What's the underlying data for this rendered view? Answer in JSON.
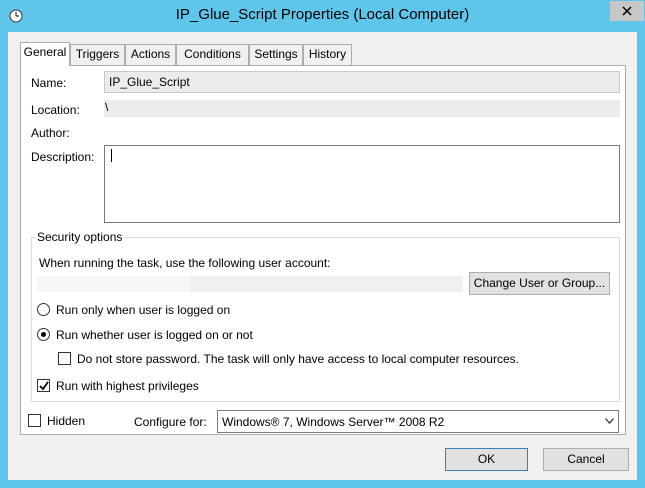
{
  "window": {
    "title": "IP_Glue_Script Properties (Local Computer)",
    "close_icon": "close-icon",
    "app_icon": "clock-icon"
  },
  "tabs": [
    {
      "label": "General",
      "active": true
    },
    {
      "label": "Triggers"
    },
    {
      "label": "Actions"
    },
    {
      "label": "Conditions"
    },
    {
      "label": "Settings"
    },
    {
      "label": "History"
    }
  ],
  "general": {
    "name_label": "Name:",
    "name_value": "IP_Glue_Script",
    "location_label": "Location:",
    "location_value": "\\",
    "author_label": "Author:",
    "author_value": "",
    "description_label": "Description:",
    "description_value": ""
  },
  "security": {
    "legend": "Security options",
    "account_prompt": "When running the task, use the following user account:",
    "account_value": "",
    "change_user_button": "Change User or Group...",
    "radio_logged_on": "Run only when user is logged on",
    "radio_whether": "Run whether user is logged on or not",
    "selected_radio": "whether",
    "no_store_password": "Do not store password.  The task will only have access to local computer resources.",
    "no_store_password_checked": false,
    "highest_privileges": "Run with highest privileges",
    "highest_privileges_checked": true
  },
  "footer_options": {
    "hidden_label": "Hidden",
    "hidden_checked": false,
    "configure_label": "Configure for:",
    "configure_value": "Windows® 7, Windows Server™ 2008 R2"
  },
  "buttons": {
    "ok": "OK",
    "cancel": "Cancel"
  },
  "colors": {
    "title_bar": "#5ec6ea",
    "dialog_bg": "#f0f0f0",
    "default_button_border": "#3c7fb1"
  }
}
